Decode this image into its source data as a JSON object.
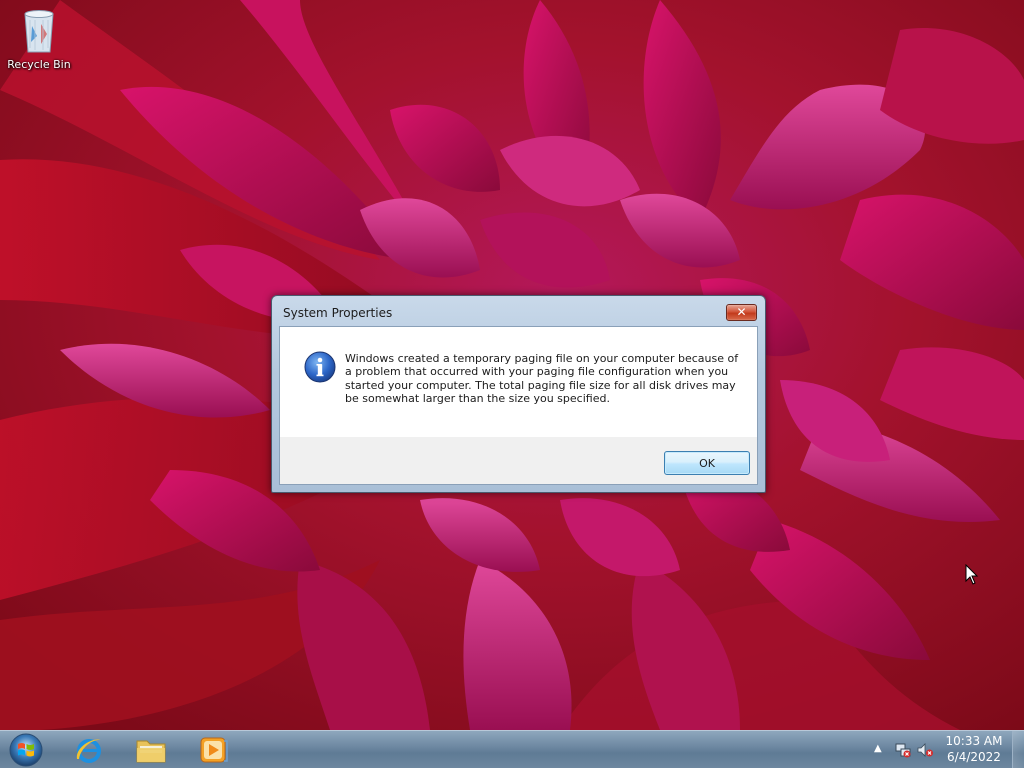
{
  "desktop": {
    "icons": [
      {
        "label": "Recycle Bin",
        "icon": "recycle-bin-icon"
      }
    ]
  },
  "dialog": {
    "title": "System Properties",
    "close_label": "✕",
    "icon": "info-icon",
    "message": "Windows created a temporary paging file on your computer because of a problem that occurred with your paging file configuration when you started your computer.  The total paging file size for all disk drives may be somewhat larger than the size you specified.",
    "ok_label": "OK"
  },
  "taskbar": {
    "start_icon": "windows-start-icon",
    "pinned": [
      {
        "name": "Internet Explorer",
        "icon": "internet-explorer-icon"
      },
      {
        "name": "Windows Explorer",
        "icon": "folder-icon"
      },
      {
        "name": "Windows Media Player",
        "icon": "media-player-icon"
      }
    ],
    "tray": {
      "chevron": "▲",
      "time": "10:33 AM",
      "date": "6/4/2022"
    }
  },
  "colors": {
    "taskbar": "#6f8aa3",
    "dialog_frame": "#b3c8de",
    "close_button": "#c23a1c",
    "ok_button_border": "#3c7fb1"
  }
}
